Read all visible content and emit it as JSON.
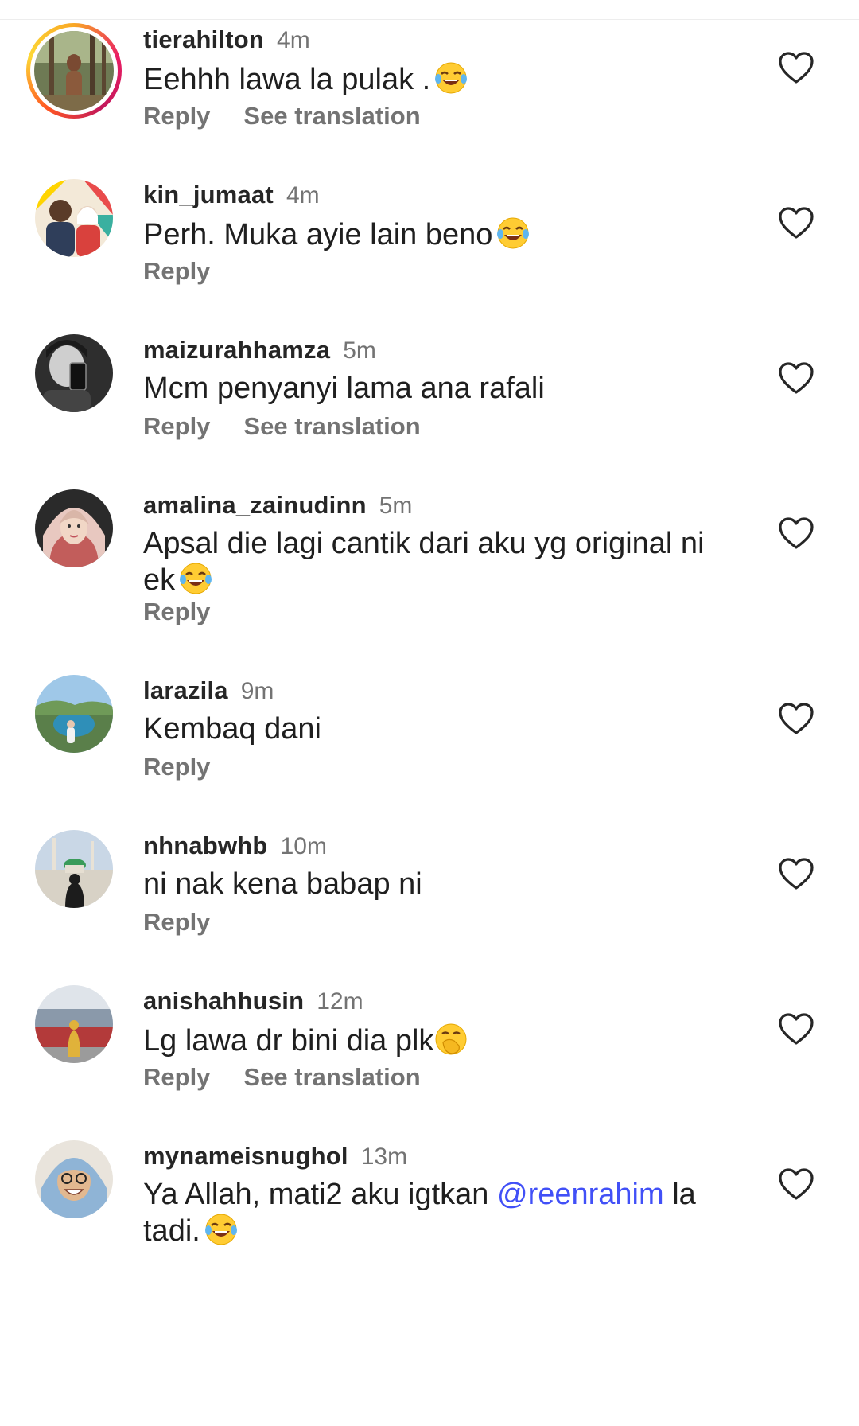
{
  "comments": [
    {
      "username": "tierahilton",
      "time": "4m",
      "text": "Eehhh lawa la pulak .",
      "emoji": "face-with-tears-of-joy",
      "reply_label": "Reply",
      "translate_label": "See translation",
      "has_story_ring": true
    },
    {
      "username": "kin_jumaat",
      "time": "4m",
      "text": "Perh. Muka ayie lain beno",
      "emoji": "face-with-tears-of-joy",
      "reply_label": "Reply"
    },
    {
      "username": "maizurahhamza",
      "time": "5m",
      "text": "Mcm penyanyi lama ana rafali",
      "reply_label": "Reply",
      "translate_label": "See translation"
    },
    {
      "username": "amalina_zainudinn",
      "time": "5m",
      "text": "Apsal die lagi cantik dari aku yg original ni ek",
      "emoji": "face-with-tears-of-joy",
      "reply_label": "Reply"
    },
    {
      "username": "larazila",
      "time": "9m",
      "text": "Kembaq dani",
      "reply_label": "Reply"
    },
    {
      "username": "nhnabwhb",
      "time": "10m",
      "text": "ni nak kena babap ni",
      "reply_label": "Reply"
    },
    {
      "username": "anishahhusin",
      "time": "12m",
      "text": "Lg lawa dr bini dia plk",
      "emoji": "face-with-hand-over-mouth",
      "reply_label": "Reply",
      "translate_label": "See translation"
    },
    {
      "username": "mynameisnughol",
      "time": "13m",
      "text_before": "Ya Allah, mati2 aku igtkan ",
      "mention": "@reenrahim",
      "text_after": " la tadi.",
      "emoji": "face-with-tears-of-joy"
    }
  ],
  "icons": {
    "like": "heart-outline-icon"
  },
  "colors": {
    "text": "#1f1f1f",
    "secondary": "#737373",
    "mention": "#4150f7"
  }
}
